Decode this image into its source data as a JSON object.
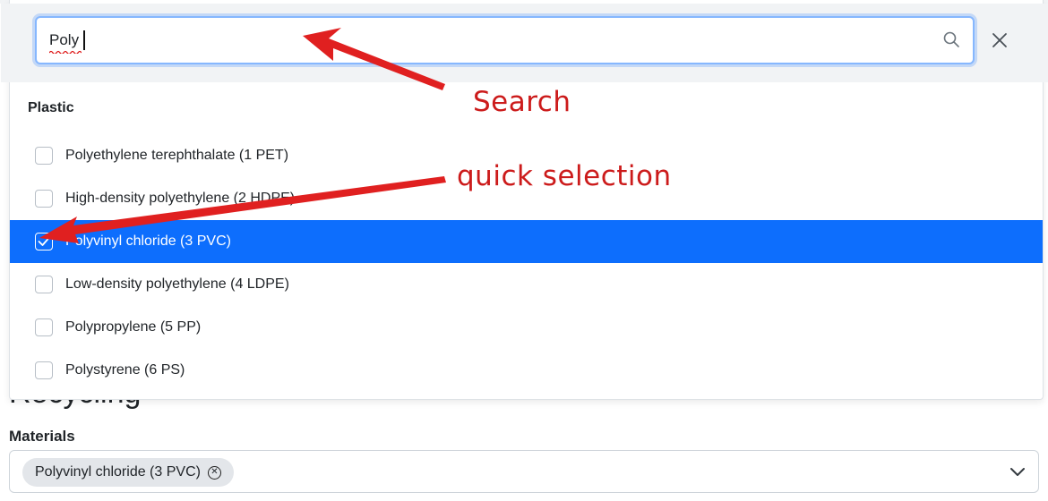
{
  "search": {
    "value": "Poly"
  },
  "dropdown": {
    "group_label": "Plastic",
    "options": [
      {
        "label": "Polyethylene terephthalate (1 PET)",
        "checked": false
      },
      {
        "label": "High-density polyethylene (2 HDPE)",
        "checked": false
      },
      {
        "label": "Polyvinyl chloride (3 PVC)",
        "checked": true
      },
      {
        "label": "Low-density polyethylene (4 LDPE)",
        "checked": false
      },
      {
        "label": "Polypropylene (5 PP)",
        "checked": false
      },
      {
        "label": "Polystyrene (6 PS)",
        "checked": false
      }
    ]
  },
  "page": {
    "heading": "Recycling",
    "field_label": "Materials",
    "selected_chip": "Polyvinyl chloride (3 PVC)"
  },
  "annotations": {
    "search_note": "Search",
    "selection_note": "quick selection"
  },
  "icons": {
    "search": "search-icon",
    "close": "close-icon",
    "chevron": "chevron-down-icon",
    "chip_remove": "remove-circle-icon",
    "check": "check-icon"
  },
  "colors": {
    "accent": "#0d6efd",
    "annotation": "#cc1b1b",
    "focus_border": "#86b7fe"
  }
}
